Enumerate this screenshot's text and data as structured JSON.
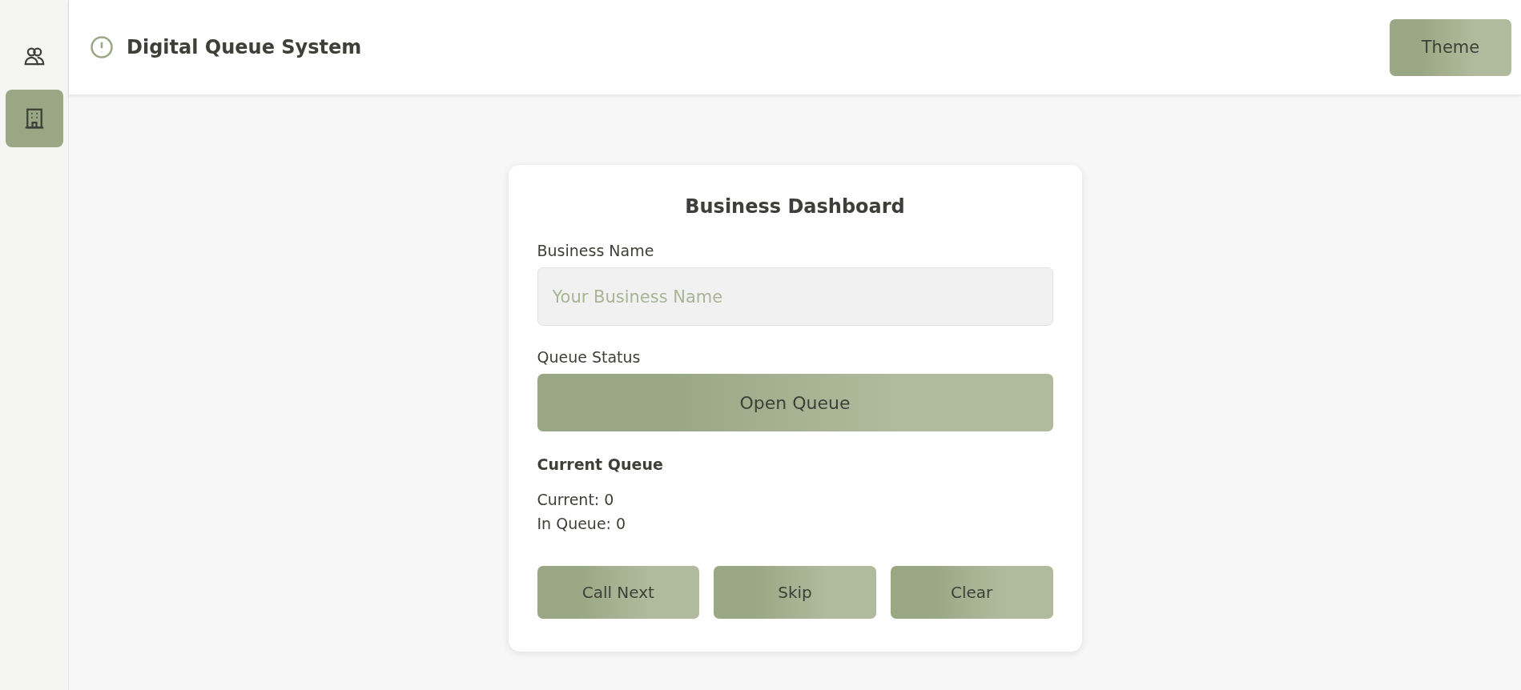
{
  "sidebar": {
    "items": [
      {
        "kind": "people",
        "selected": false
      },
      {
        "kind": "building",
        "selected": true
      }
    ]
  },
  "header": {
    "title": "Digital Queue System",
    "theme_button": "Theme"
  },
  "card": {
    "title": "Business Dashboard",
    "name_label": "Business Name",
    "name_field": {
      "placeholder": "Your Business Name"
    },
    "status_label": "Queue Status",
    "status_button": "Open Queue",
    "queue_heading": "Current Queue",
    "stats": [
      "Current: 0",
      "In Queue: 0"
    ],
    "buttons": [
      "Call Next",
      "Skip",
      "Clear"
    ]
  }
}
